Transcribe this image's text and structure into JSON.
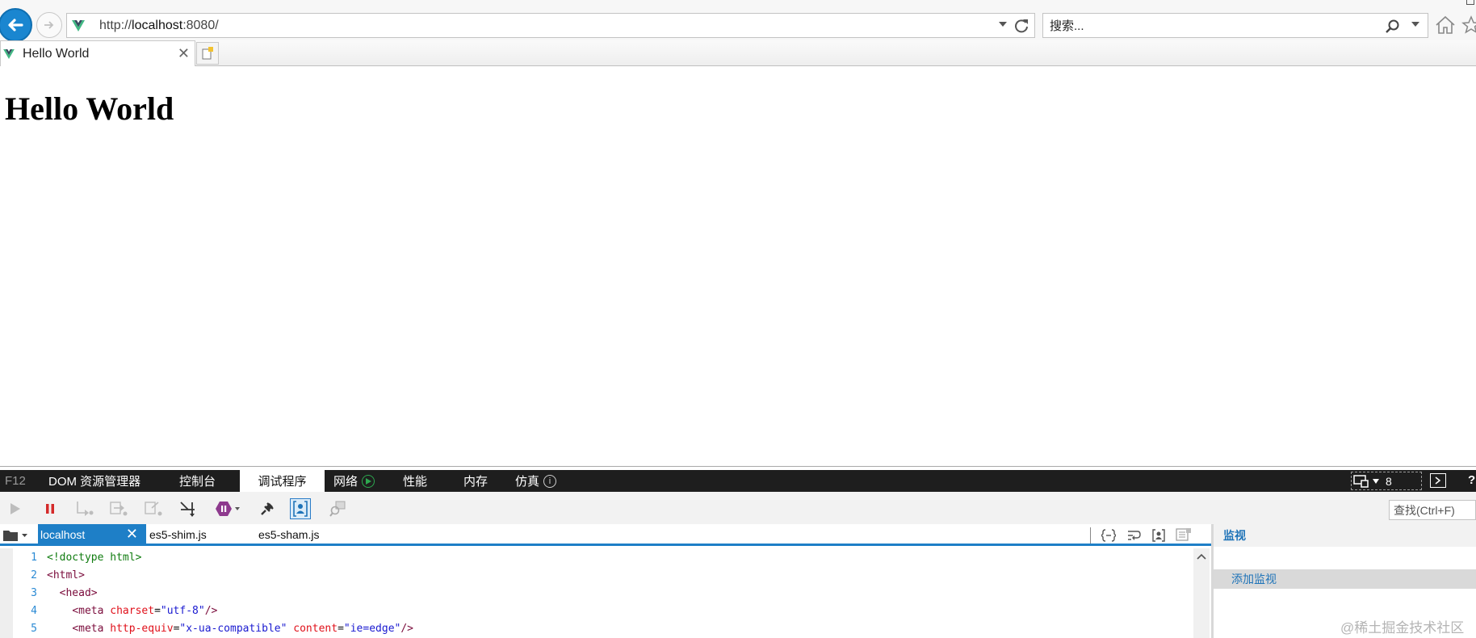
{
  "browser": {
    "url_prefix": "http://",
    "url_host": "localhost",
    "url_suffix": ":8080/",
    "search_placeholder": "搜索...",
    "tab_title": "Hello World"
  },
  "page": {
    "heading": "Hello World"
  },
  "devtools": {
    "tabs": [
      {
        "label": "F12"
      },
      {
        "label": "DOM 资源管理器"
      },
      {
        "label": "控制台"
      },
      {
        "label": "调试程序"
      },
      {
        "label": "网络"
      },
      {
        "label": "性能"
      },
      {
        "label": "内存"
      },
      {
        "label": "仿真"
      }
    ],
    "active_tab": "调试程序",
    "doc_mode": "8",
    "help": "?",
    "find_placeholder": "查找(Ctrl+F)",
    "file_tabs": [
      {
        "label": "localhost"
      },
      {
        "label": "es5-shim.js"
      },
      {
        "label": "es5-sham.js"
      }
    ],
    "code_lines": [
      {
        "num": "1",
        "text": "<!doctype html>"
      },
      {
        "num": "2",
        "tag": "<html>"
      },
      {
        "num": "3",
        "indent": "  ",
        "tag": "<head>"
      },
      {
        "num": "4",
        "indent": "    ",
        "tag_open": "<meta",
        "attr1": "charset",
        "eq1": "=",
        "val1": "\"utf-8\"",
        "tag_close": "/>"
      },
      {
        "num": "5",
        "indent": "    ",
        "tag_open": "<meta",
        "attr1": "http-equiv",
        "eq1": "=",
        "val1": "\"x-ua-compatible\"",
        "attr2": "content",
        "eq2": "=",
        "val2": "\"ie=edge\"",
        "tag_close": "/>"
      }
    ],
    "watch": {
      "title": "监视",
      "add_label": "添加监视"
    }
  },
  "watermark": "@稀土掘金技术社区",
  "colors": {
    "accent_blue": "#1e7fc7",
    "devtools_bar": "#1e1e1e",
    "vue_green": "#41b883",
    "vue_dark": "#35495e"
  }
}
